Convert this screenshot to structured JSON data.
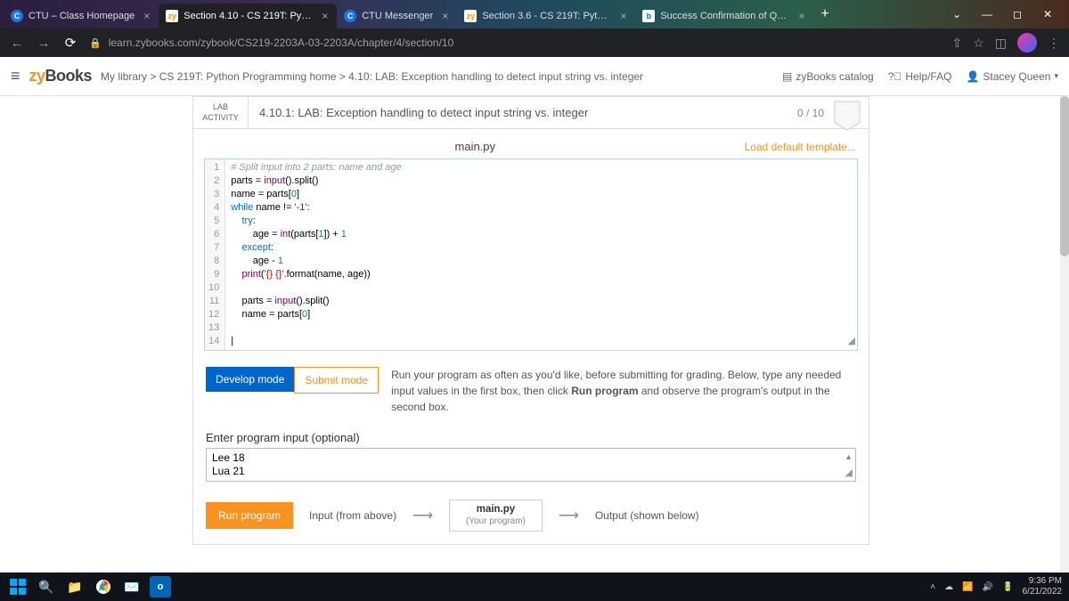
{
  "tabs": [
    {
      "favicon": "ctu",
      "label": "CTU – Class Homepage"
    },
    {
      "favicon": "zy",
      "label": "Section 4.10 - CS 219T: Python P…",
      "active": true
    },
    {
      "favicon": "ctu",
      "label": "CTU Messenger"
    },
    {
      "favicon": "zy",
      "label": "Section 3.6 - CS 219T: Python Pr…"
    },
    {
      "favicon": "b",
      "label": "Success Confirmation of Questi…"
    }
  ],
  "url": "learn.zybooks.com/zybook/CS219-2203A-03-2203A/chapter/4/section/10",
  "zyheader": {
    "logo_zy": "zy",
    "logo_books": "Books",
    "breadcrumb": "My library > CS 219T: Python Programming home > 4.10: LAB: Exception handling to detect input string vs. integer",
    "catalog": "zyBooks catalog",
    "help": "Help/FAQ",
    "user": "Stacey Queen"
  },
  "lab": {
    "label_top": "LAB",
    "label_bot": "ACTIVITY",
    "title": "4.10.1: LAB: Exception handling to detect input string vs. integer",
    "score": "0 / 10",
    "filename": "main.py",
    "load_link": "Load default template...",
    "mode_dev": "Develop mode",
    "mode_sub": "Submit mode",
    "mode_text_a": "Run your program as often as you'd like, before submitting for grading. Below, type any needed input values in the first box, then click ",
    "mode_text_b": "Run program",
    "mode_text_c": " and observe the program's output in the second box.",
    "input_label": "Enter program input (optional)",
    "input_value": "Lee 18\nLua 21",
    "run_btn": "Run program",
    "flow_input": "Input (from above)",
    "flow_prog_file": "main.py",
    "flow_prog_sub": "(Your program)",
    "flow_output": "Output (shown below)"
  },
  "code": {
    "lines": [
      "1",
      "2",
      "3",
      "4",
      "5",
      "6",
      "7",
      "8",
      "9",
      "10",
      "11",
      "12",
      "13",
      "14"
    ]
  },
  "clock": {
    "time": "9:36 PM",
    "date": "6/21/2022"
  }
}
